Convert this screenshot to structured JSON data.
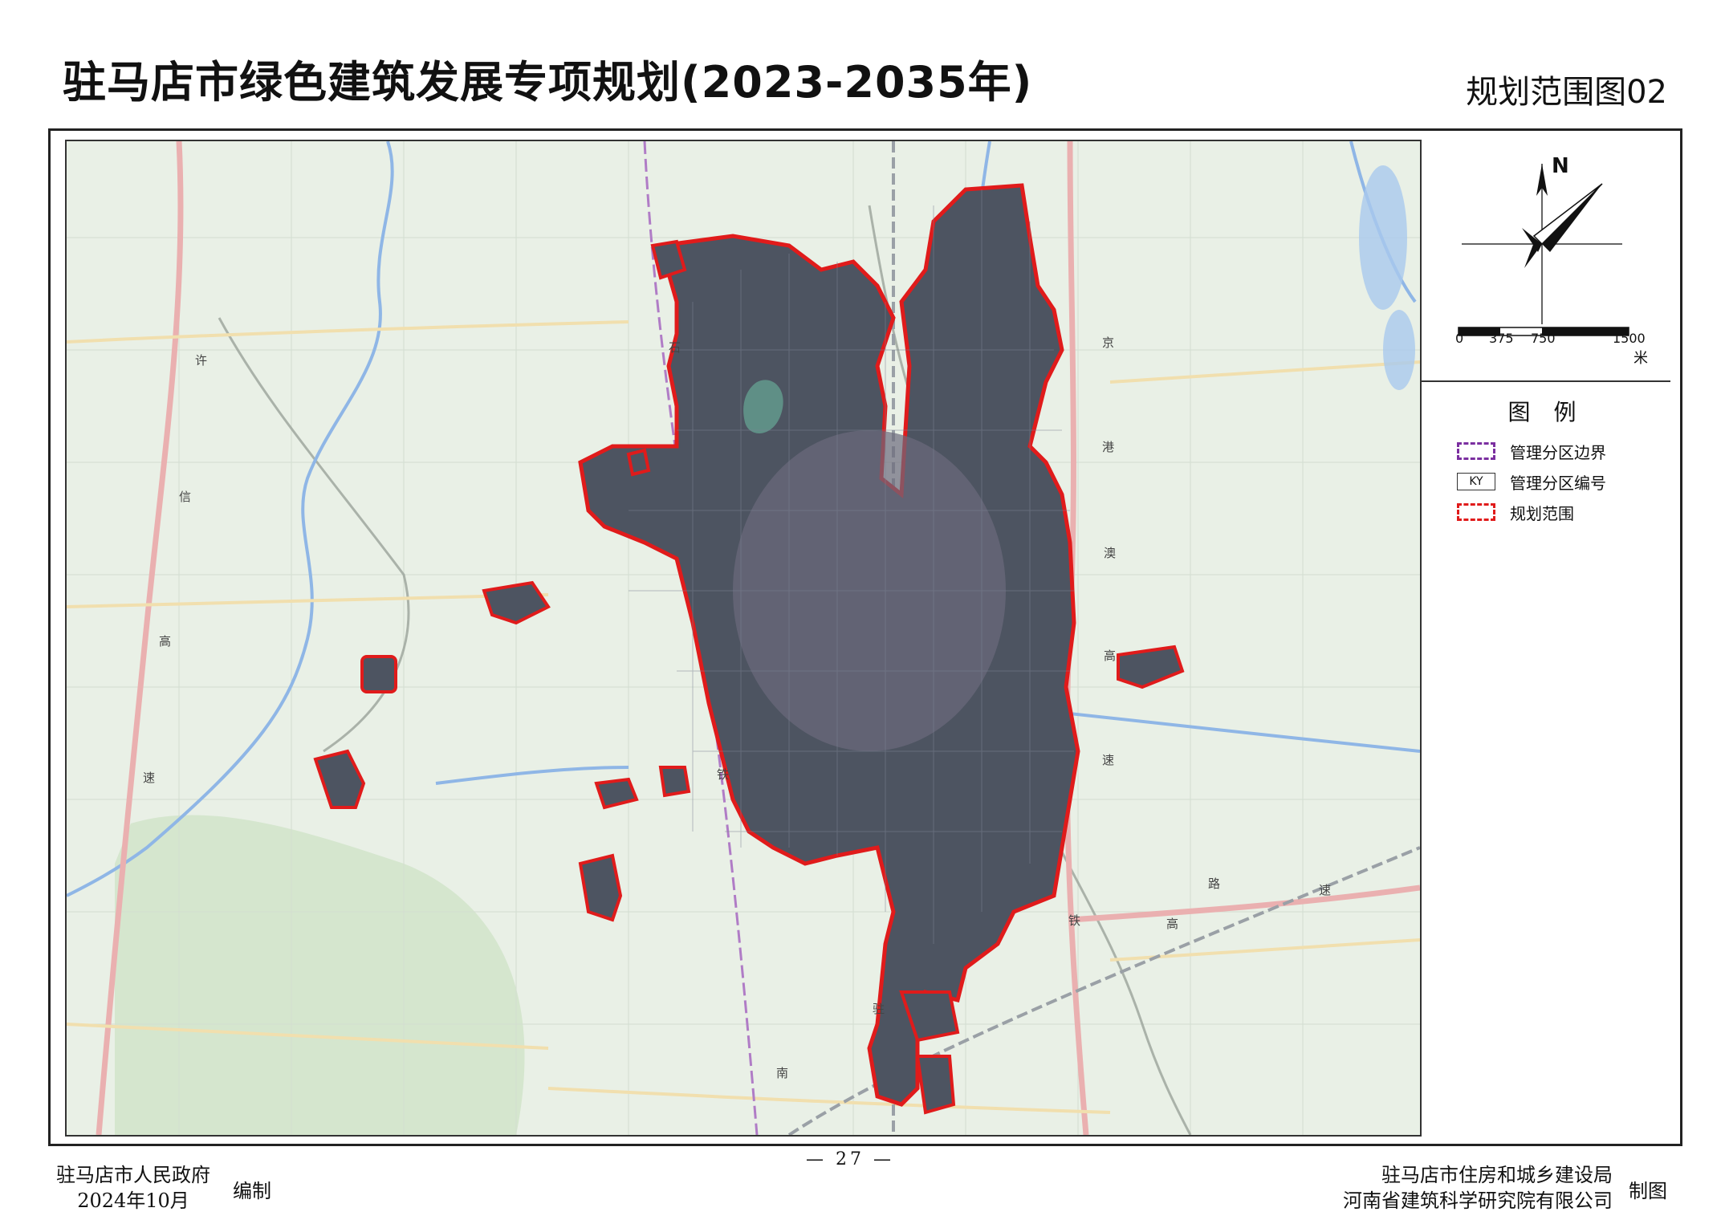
{
  "header": {
    "title": "驻马店市绿色建筑发展专项规划(2023-2035年)",
    "subtitle": "规划范围图02"
  },
  "compass": {
    "north_label": "N"
  },
  "scale_bar": {
    "labels": [
      "0",
      "375",
      "750",
      "1500"
    ],
    "unit": "米"
  },
  "legend": {
    "title": "图 例",
    "items": [
      {
        "symbol": "",
        "label": "管理分区边界",
        "color": "#7b2fa0"
      },
      {
        "symbol": "KY",
        "label": "管理分区编号",
        "color": "#333333"
      },
      {
        "symbol": "",
        "label": "规划范围",
        "color": "#e01b1b"
      }
    ]
  },
  "map": {
    "road_labels": [
      "许",
      "信",
      "高",
      "速",
      "石",
      "铁",
      "京",
      "港",
      "澳",
      "高",
      "速",
      "路",
      "速",
      "高",
      "驻",
      "南",
      "铁"
    ],
    "colors": {
      "base": "#e8efe4",
      "urban": "#4a4f5a",
      "boundary": "#e01b1b",
      "rail": "#b07cc6",
      "highway": "#e8a5a5",
      "river": "#8fb6e6"
    }
  },
  "footer": {
    "left_org": "驻马店市人民政府",
    "left_date": "2024年10月",
    "left_tag": "编制",
    "page": "— 27 —",
    "right_org1": "驻马店市住房和城乡建设局",
    "right_org2": "河南省建筑科学研究院有限公司",
    "right_tag": "制图"
  }
}
